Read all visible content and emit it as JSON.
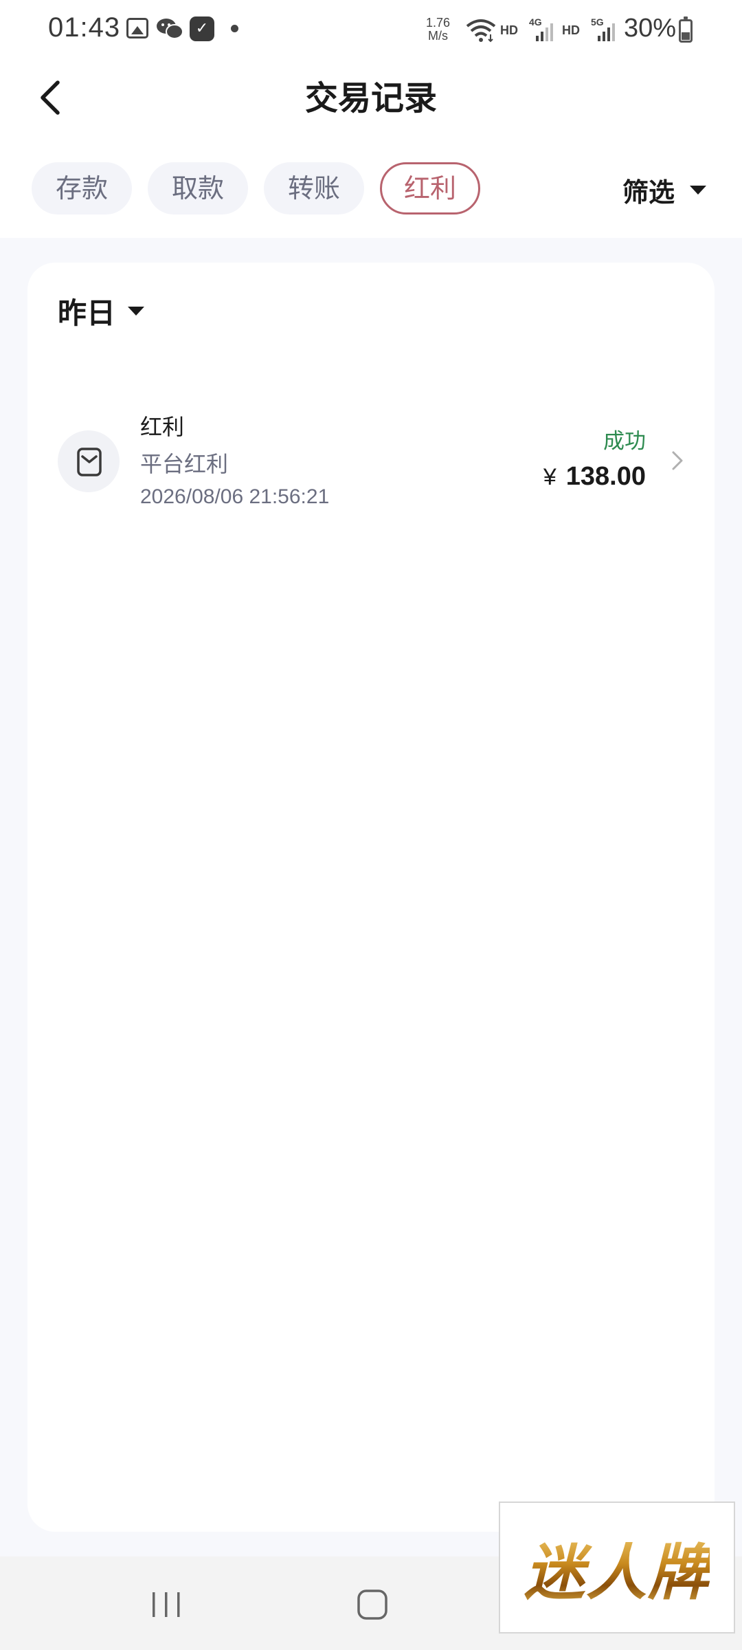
{
  "status_bar": {
    "time": "01:43",
    "speed_value": "1.76",
    "speed_unit": "M/s",
    "hd1": "HD",
    "net1": "4G",
    "hd2": "HD",
    "net2": "5G",
    "battery": "30%"
  },
  "header": {
    "title": "交易记录",
    "back_icon": "chevron-left-icon"
  },
  "tabs": [
    {
      "label": "存款",
      "active": false
    },
    {
      "label": "取款",
      "active": false
    },
    {
      "label": "转账",
      "active": false
    },
    {
      "label": "红利",
      "active": true
    }
  ],
  "filter": {
    "label": "筛选",
    "icon": "caret-down-icon"
  },
  "date_group": {
    "label": "昨日",
    "icon": "caret-down-icon"
  },
  "transactions": [
    {
      "title": "红利",
      "subtitle": "平台红利",
      "time": "2026/08/06 21:56:21",
      "status": "成功",
      "currency": "¥",
      "amount": "138.00",
      "icon": "wallet-icon"
    }
  ],
  "watermark": {
    "text": "迷人牌"
  },
  "colors": {
    "accent": "#b8636e",
    "success": "#2e8b50",
    "page_bg": "#f7f8fc",
    "muted": "#6b6e80"
  }
}
